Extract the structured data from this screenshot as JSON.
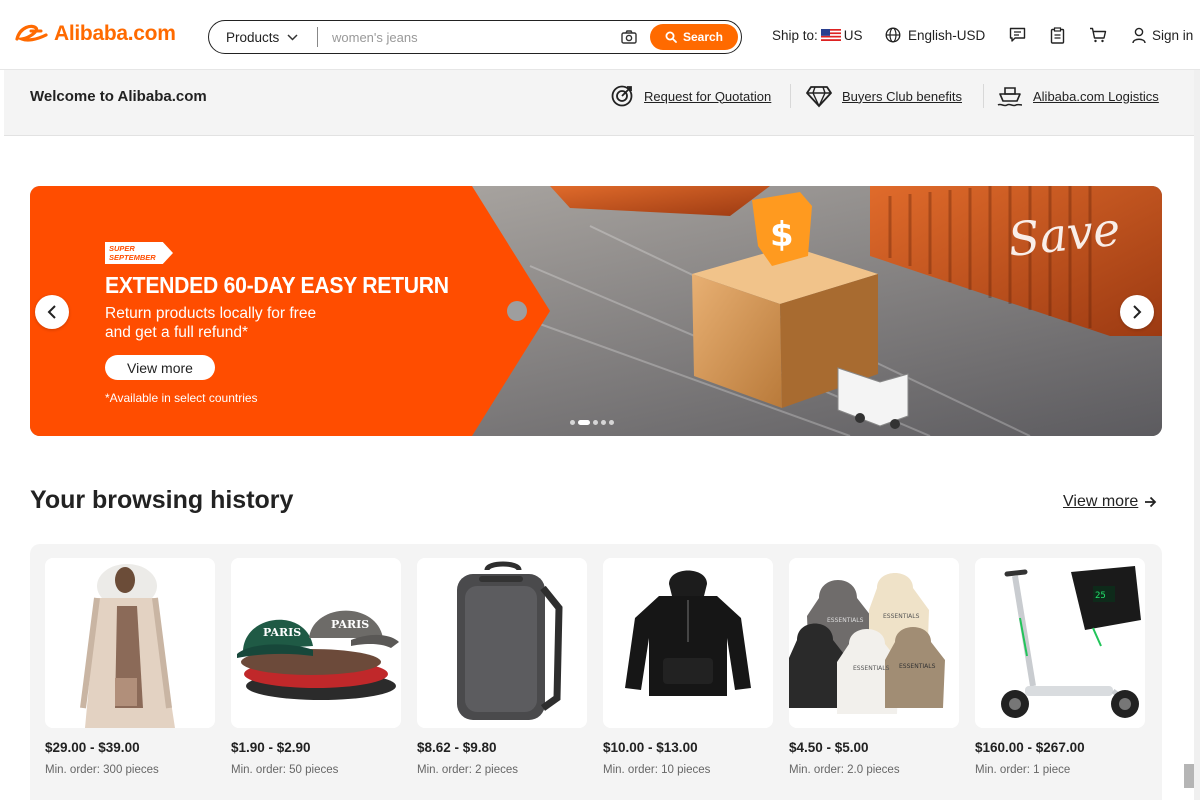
{
  "header": {
    "logo_text": "Alibaba.com",
    "search": {
      "category_label": "Products",
      "placeholder": "women's jeans",
      "button_label": "Search"
    },
    "ship_to_label": "Ship to:",
    "ship_to_country": "US",
    "language_label": "English-USD",
    "signin_label": "Sign in"
  },
  "subbar": {
    "welcome": "Welcome to Alibaba.com",
    "links": [
      {
        "label": "Request for Quotation",
        "icon": "target-icon"
      },
      {
        "label": "Buyers Club benefits",
        "icon": "diamond-icon"
      },
      {
        "label": "Alibaba.com Logistics",
        "icon": "ship-icon"
      }
    ]
  },
  "banner": {
    "badge_line1": "SUPER",
    "badge_line2": "SEPTEMBER",
    "title": "EXTENDED 60-DAY EASY RETURN",
    "subtitle": "Return products locally for free and get a full refund*",
    "button_label": "View more",
    "note": "*Available in select countries",
    "overlay_text": "Save",
    "slide_count": 5,
    "active_slide": 2
  },
  "history": {
    "title": "Your browsing history",
    "view_more": "View more",
    "items": [
      {
        "price": "$29.00 - $39.00",
        "min_order": "Min. order: 300 pieces",
        "image": "coat-image"
      },
      {
        "price": "$1.90 - $2.90",
        "min_order": "Min. order: 50 pieces",
        "image": "caps-image"
      },
      {
        "price": "$8.62 - $9.80",
        "min_order": "Min. order: 2 pieces",
        "image": "backpack-image"
      },
      {
        "price": "$10.00 - $13.00",
        "min_order": "Min. order: 10 pieces",
        "image": "hoodie-image"
      },
      {
        "price": "$4.50 - $5.00",
        "min_order": "Min. order: 2.0 pieces",
        "image": "hoodies-set-image"
      },
      {
        "price": "$160.00 - $267.00",
        "min_order": "Min. order: 1 piece",
        "image": "scooter-image"
      }
    ]
  },
  "colors": {
    "brand": "#ff6a00",
    "banner_orange": "#ff4d00"
  }
}
